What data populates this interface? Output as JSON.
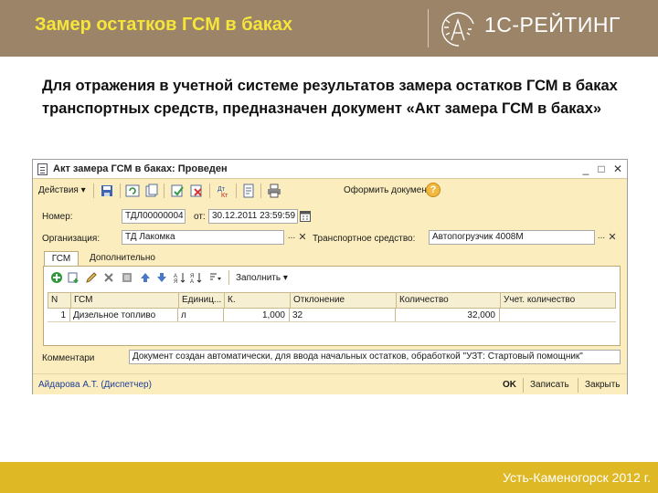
{
  "slide": {
    "title": "Замер остатков ГСМ в баках",
    "brand": "1С-РЕЙТИНГ",
    "intro": "Для отражения в учетной системе результатов замера остатков ГСМ в баках транспортных средств, предназначен документ «Акт замера ГСМ в баках»",
    "footer": "Усть-Каменогорск 2012 г.",
    "colors": {
      "header_bg": "#9b8467",
      "title": "#f6e53a",
      "footer_bg": "#dfb825",
      "window_bg": "#fbedbd"
    }
  },
  "window": {
    "title": "Акт замера ГСМ в баках: Проведен",
    "controls": {
      "minimize": "_",
      "restore": "□",
      "close": "✕"
    },
    "toolbar": {
      "actions_label": "Действия ▾",
      "print_label": "Оформить документы",
      "help_label": "?",
      "icons": [
        "save-icon",
        "refresh-icon",
        "post-icon",
        "unpost-icon",
        "debit-credit-icon",
        "structure-icon",
        "print-icon",
        "help-icon"
      ]
    },
    "form": {
      "number_label": "Номер:",
      "number_value": "ТДЛ00000004",
      "date_label": "от:",
      "date_value": "30.12.2011 23:59:59",
      "org_label": "Организация:",
      "org_value": "ТД Лакомка",
      "vehicle_label": "Транспортное средство:",
      "vehicle_value": "Автопогрузчик 4008М",
      "dots": "...",
      "clear": "✕"
    },
    "tabs": [
      {
        "label": "ГСМ"
      },
      {
        "label": "Дополнительно"
      }
    ],
    "table_toolbar": {
      "fill_label": "Заполнить ▾",
      "icons": [
        "add-row-icon",
        "copy-row-icon",
        "edit-row-icon",
        "delete-row-icon",
        "move-up-icon",
        "move-down-icon",
        "sort-asc-icon",
        "sort-desc-icon"
      ]
    },
    "grid": {
      "headers": [
        "N",
        "ГСМ",
        "Единиц...",
        "К.",
        "Отклонение",
        "Количество",
        "Учет. количество"
      ],
      "rows": [
        [
          "1",
          "Дизельное топливо",
          "л",
          "1,000",
          "32",
          "32,000",
          ""
        ]
      ]
    },
    "comment_label": "Комментари",
    "comment_value": "Документ создан автоматически, для ввода начальных остатков, обработкой \"УЗТ: Стартовый помощник\"",
    "status": {
      "user": "Айдарова А.Т. (Диспетчер)",
      "ok": "OK",
      "save": "Записать",
      "close": "Закрыть"
    }
  }
}
